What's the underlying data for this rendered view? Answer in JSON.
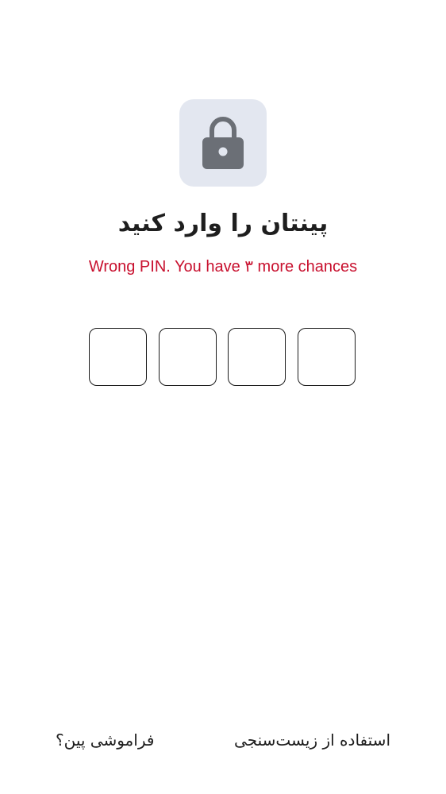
{
  "lock": {
    "icon": "lock-icon",
    "tile_color": "#e3e7f0",
    "icon_color": "#6b6f76"
  },
  "title": "پینتان را وارد کنید",
  "error_message": "Wrong PIN. You have ۳ more chances",
  "error_color": "#c8102e",
  "pin": {
    "length": 4,
    "digits": [
      "",
      "",
      "",
      ""
    ]
  },
  "actions": {
    "biometric_label": "استفاده از زیست‌سنجی",
    "forgot_label": "فراموشی پین؟"
  }
}
